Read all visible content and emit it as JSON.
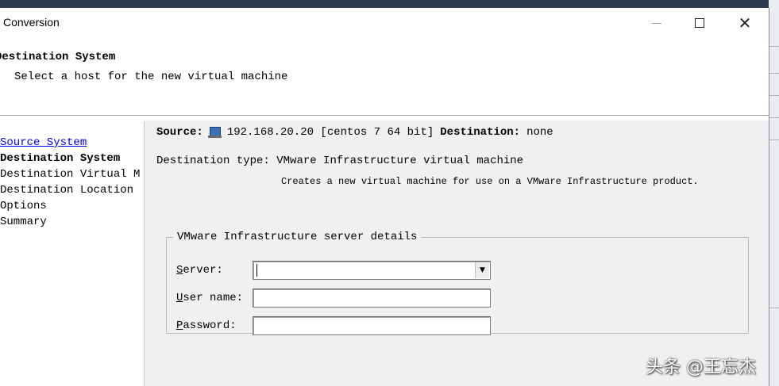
{
  "window": {
    "title": "Conversion",
    "controls": {
      "minimize": "minimize",
      "maximize": "maximize",
      "close": "close"
    }
  },
  "header": {
    "title": "Destination System",
    "subtitle": "Select a host for the new virtual machine"
  },
  "nav": {
    "steps": [
      {
        "label": "Source System",
        "state": "link"
      },
      {
        "label": "Destination System",
        "state": "active"
      },
      {
        "label": "Destination Virtual M",
        "state": "normal"
      },
      {
        "label": "Destination Location",
        "state": "normal"
      },
      {
        "label": "Options",
        "state": "normal"
      },
      {
        "label": "Summary",
        "state": "normal"
      }
    ]
  },
  "summary": {
    "source_label": "Source:",
    "source_value": "192.168.20.20 [centos 7 64 bit]",
    "destination_label": "Destination:",
    "destination_value": "none",
    "dest_type_label": "Destination type:",
    "dest_type_value": "VMware Infrastructure virtual machine",
    "dest_type_desc": "Creates a new virtual machine for use on a VMware Infrastructure product."
  },
  "server_details": {
    "legend": "VMware Infrastructure server details",
    "server": {
      "label_key": "S",
      "label_rest": "erver:",
      "value": ""
    },
    "username": {
      "label_key": "U",
      "label_rest": "ser name:",
      "value": ""
    },
    "password": {
      "label_key": "P",
      "label_rest": "assword:",
      "value": ""
    }
  },
  "watermark": "头条 @王忘杰",
  "icons": {
    "host": "server-host-icon",
    "dropdown": "chevron-down-icon"
  }
}
